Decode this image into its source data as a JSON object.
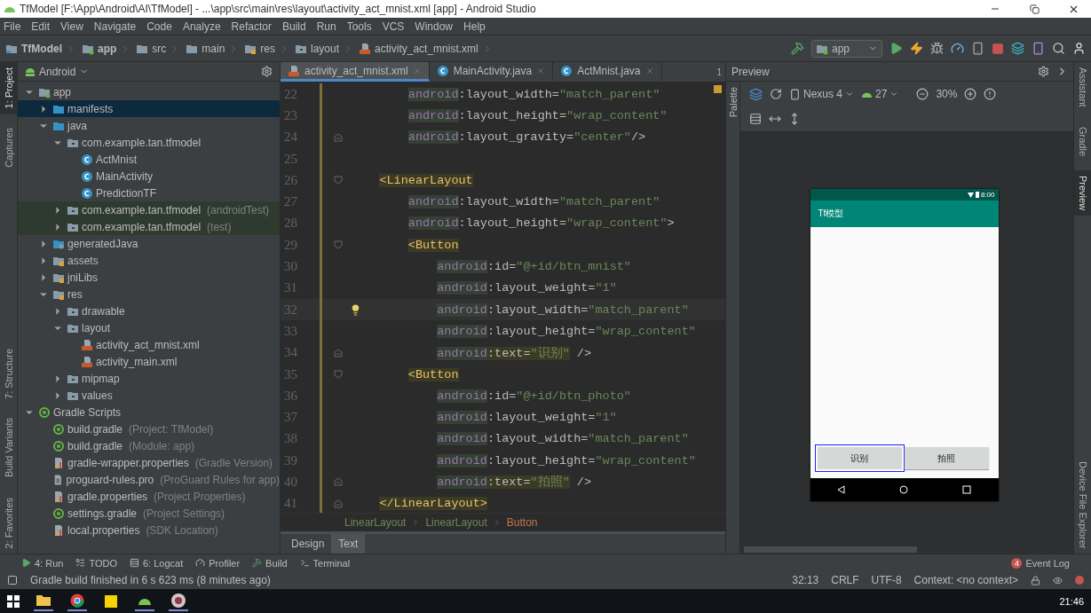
{
  "window": {
    "title": "TfModel [F:\\App\\Android\\AI\\TfModel] - ...\\app\\src\\main\\res\\layout\\activity_act_mnist.xml [app] - Android Studio"
  },
  "menu": [
    "File",
    "Edit",
    "View",
    "Navigate",
    "Code",
    "Analyze",
    "Refactor",
    "Build",
    "Run",
    "Tools",
    "VCS",
    "Window",
    "Help"
  ],
  "navigation": [
    {
      "label": "TfModel",
      "kind": "project"
    },
    {
      "label": "app",
      "kind": "module"
    },
    {
      "label": "src",
      "kind": "folder"
    },
    {
      "label": "main",
      "kind": "folder"
    },
    {
      "label": "res",
      "kind": "res"
    },
    {
      "label": "layout",
      "kind": "package"
    },
    {
      "label": "activity_act_mnist.xml",
      "kind": "layout-file"
    }
  ],
  "toolbar": {
    "run_config": "app"
  },
  "left_stripe": {
    "top": [
      {
        "label": "1: Project",
        "selected": true
      },
      {
        "label": "Captures",
        "selected": false
      }
    ],
    "bottom": [
      {
        "label": "7: Structure",
        "selected": false
      },
      {
        "label": "Build Variants",
        "selected": false
      },
      {
        "label": "2: Favorites",
        "selected": false
      }
    ]
  },
  "project_panel": {
    "view": "Android",
    "tree": [
      {
        "label": "app",
        "kind": "module",
        "selected": false,
        "expanded": true,
        "children": [
          {
            "label": "manifests",
            "kind": "blue-folder",
            "selected": true,
            "expanded": false
          },
          {
            "label": "java",
            "kind": "blue-folder",
            "selected": false,
            "expanded": true,
            "children": [
              {
                "label": "com.example.tan.tfmodel",
                "kind": "package",
                "selected": false,
                "expanded": true,
                "children": [
                  {
                    "label": "ActMnist",
                    "kind": "class",
                    "selected": false
                  },
                  {
                    "label": "MainActivity",
                    "kind": "class",
                    "selected": false
                  },
                  {
                    "label": "PredictionTF",
                    "kind": "class",
                    "selected": false
                  }
                ]
              },
              {
                "label": "com.example.tan.tfmodel",
                "note": "(androidTest)",
                "kind": "package",
                "selected": false,
                "expanded": false,
                "tinted": true
              },
              {
                "label": "com.example.tan.tfmodel",
                "note": "(test)",
                "kind": "package",
                "selected": false,
                "expanded": false,
                "tinted": true
              }
            ]
          },
          {
            "label": "generatedJava",
            "kind": "generated",
            "selected": false,
            "expanded": false
          },
          {
            "label": "assets",
            "kind": "res",
            "selected": false,
            "expanded": false
          },
          {
            "label": "jniLibs",
            "kind": "res",
            "selected": false,
            "expanded": false
          },
          {
            "label": "res",
            "kind": "res",
            "selected": false,
            "expanded": true,
            "children": [
              {
                "label": "drawable",
                "kind": "package",
                "selected": false,
                "expanded": false
              },
              {
                "label": "layout",
                "kind": "package",
                "selected": false,
                "expanded": true,
                "children": [
                  {
                    "label": "activity_act_mnist.xml",
                    "kind": "layout-file",
                    "selected": false
                  },
                  {
                    "label": "activity_main.xml",
                    "kind": "layout-file",
                    "selected": false
                  }
                ]
              },
              {
                "label": "mipmap",
                "kind": "package",
                "selected": false,
                "expanded": false
              },
              {
                "label": "values",
                "kind": "package",
                "selected": false,
                "expanded": false
              }
            ]
          }
        ]
      },
      {
        "label": "Gradle Scripts",
        "kind": "gradle",
        "selected": false,
        "expanded": true,
        "children": [
          {
            "label": "build.gradle",
            "note": "(Project: TfModel)",
            "kind": "gradle",
            "selected": false
          },
          {
            "label": "build.gradle",
            "note": "(Module: app)",
            "kind": "gradle",
            "selected": false
          },
          {
            "label": "gradle-wrapper.properties",
            "note": "(Gradle Version)",
            "kind": "properties",
            "selected": false
          },
          {
            "label": "proguard-rules.pro",
            "note": "(ProGuard Rules for app)",
            "kind": "text-file",
            "selected": false
          },
          {
            "label": "gradle.properties",
            "note": "(Project Properties)",
            "kind": "properties",
            "selected": false
          },
          {
            "label": "settings.gradle",
            "note": "(Project Settings)",
            "kind": "gradle",
            "selected": false
          },
          {
            "label": "local.properties",
            "note": "(SDK Location)",
            "kind": "properties",
            "selected": false
          }
        ]
      }
    ]
  },
  "editor": {
    "tabs": [
      {
        "label": "activity_act_mnist.xml",
        "kind": "layout-file",
        "selected": true
      },
      {
        "label": "MainActivity.java",
        "kind": "class",
        "selected": false
      },
      {
        "label": "ActMnist.java",
        "kind": "class",
        "selected": false
      }
    ],
    "tab_overflow": "1",
    "lines": [
      {
        "number": "22",
        "tokens": [
          {
            "kind": "ns",
            "text": "        android"
          },
          {
            "kind": "attr",
            "text": ":layout_width="
          },
          {
            "kind": "value",
            "text": "\"match_parent\""
          }
        ]
      },
      {
        "number": "23",
        "tokens": [
          {
            "kind": "ns",
            "text": "        android"
          },
          {
            "kind": "attr",
            "text": ":layout_height="
          },
          {
            "kind": "value",
            "text": "\"wrap_content\""
          }
        ]
      },
      {
        "number": "24",
        "fold_end": true,
        "tokens": [
          {
            "kind": "ns",
            "text": "        android"
          },
          {
            "kind": "attr",
            "text": ":layout_gravity="
          },
          {
            "kind": "value",
            "text": "\"center\""
          },
          {
            "kind": "punct",
            "text": "/>"
          }
        ]
      },
      {
        "number": "25"
      },
      {
        "number": "26",
        "fold_start": true,
        "tokens": [
          {
            "kind": "tag",
            "text": "    <LinearLayout"
          }
        ]
      },
      {
        "number": "27",
        "tokens": [
          {
            "kind": "ns",
            "text": "        android"
          },
          {
            "kind": "attr",
            "text": ":layout_width="
          },
          {
            "kind": "value",
            "text": "\"match_parent\""
          }
        ]
      },
      {
        "number": "28",
        "tokens": [
          {
            "kind": "ns",
            "text": "        android"
          },
          {
            "kind": "attr",
            "text": ":layout_height="
          },
          {
            "kind": "value",
            "text": "\"wrap_content\""
          },
          {
            "kind": "punct",
            "text": ">"
          }
        ]
      },
      {
        "number": "29",
        "fold_start": true,
        "tokens": [
          {
            "kind": "tag",
            "text": "        <Button"
          }
        ]
      },
      {
        "number": "30",
        "tokens": [
          {
            "kind": "ns",
            "text": "            android"
          },
          {
            "kind": "attr",
            "text": ":id="
          },
          {
            "kind": "value",
            "text": "\"@+id/btn_mnist\""
          }
        ]
      },
      {
        "number": "31",
        "tokens": [
          {
            "kind": "ns",
            "text": "            android"
          },
          {
            "kind": "attr",
            "text": ":layout_weight="
          },
          {
            "kind": "value",
            "text": "\"1\""
          }
        ]
      },
      {
        "number": "32",
        "current": true,
        "bulb": true,
        "tokens": [
          {
            "kind": "ns",
            "text": "            android"
          },
          {
            "kind": "attr",
            "text": ":layout_width="
          },
          {
            "kind": "value",
            "text": "\"match_parent\""
          }
        ]
      },
      {
        "number": "33",
        "tokens": [
          {
            "kind": "ns",
            "text": "            android"
          },
          {
            "kind": "attr",
            "text": ":layout_height="
          },
          {
            "kind": "value",
            "text": "\"wrap_content\""
          }
        ]
      },
      {
        "number": "34",
        "fold_end": true,
        "tokens": [
          {
            "kind": "ns",
            "text": "            android"
          },
          {
            "kind": "attr-hl",
            "text": ":text="
          },
          {
            "kind": "value-hl",
            "text": "\"识别\""
          },
          {
            "kind": "punct",
            "text": " />"
          }
        ]
      },
      {
        "number": "35",
        "fold_start": true,
        "tokens": [
          {
            "kind": "tag",
            "text": "        <Button"
          }
        ]
      },
      {
        "number": "36",
        "tokens": [
          {
            "kind": "ns",
            "text": "            android"
          },
          {
            "kind": "attr",
            "text": ":id="
          },
          {
            "kind": "value",
            "text": "\"@+id/btn_photo\""
          }
        ]
      },
      {
        "number": "37",
        "tokens": [
          {
            "kind": "ns",
            "text": "            android"
          },
          {
            "kind": "attr",
            "text": ":layout_weight="
          },
          {
            "kind": "value",
            "text": "\"1\""
          }
        ]
      },
      {
        "number": "38",
        "tokens": [
          {
            "kind": "ns",
            "text": "            android"
          },
          {
            "kind": "attr",
            "text": ":layout_width="
          },
          {
            "kind": "value",
            "text": "\"match_parent\""
          }
        ]
      },
      {
        "number": "39",
        "tokens": [
          {
            "kind": "ns",
            "text": "            android"
          },
          {
            "kind": "attr",
            "text": ":layout_height="
          },
          {
            "kind": "value",
            "text": "\"wrap_content\""
          }
        ]
      },
      {
        "number": "40",
        "fold_end": true,
        "tokens": [
          {
            "kind": "ns",
            "text": "            android"
          },
          {
            "kind": "attr-hl",
            "text": ":text="
          },
          {
            "kind": "value-hl",
            "text": "\"拍照\""
          },
          {
            "kind": "punct",
            "text": " />"
          }
        ]
      },
      {
        "number": "41",
        "fold_end": true,
        "tokens": [
          {
            "kind": "tag",
            "text": "    </LinearLayout>"
          }
        ]
      }
    ],
    "breadcrumb": [
      {
        "label": "LinearLayout",
        "selected": false
      },
      {
        "label": "LinearLayout",
        "selected": false
      },
      {
        "label": "Button",
        "selected": true
      }
    ],
    "mode_tabs": [
      {
        "label": "Design",
        "selected": false
      },
      {
        "label": "Text",
        "selected": true
      }
    ]
  },
  "preview": {
    "title": "Preview",
    "palette": "Palette",
    "device": "Nexus 4",
    "api": "27",
    "zoom": "30%",
    "phone": {
      "time": "8:00",
      "app_title": "Tf模型",
      "buttons": [
        {
          "label": "识别",
          "selected": true
        },
        {
          "label": "拍照",
          "selected": false
        }
      ]
    }
  },
  "right_stripe": {
    "top": [
      {
        "label": "Assistant",
        "selected": false
      },
      {
        "label": "Gradle",
        "selected": false
      },
      {
        "label": "Preview",
        "selected": true
      }
    ],
    "bottom": [
      {
        "label": "Device File Explorer",
        "selected": false
      }
    ]
  },
  "tool_windows": [
    {
      "label": "4: Run",
      "kind": "run"
    },
    {
      "label": "TODO",
      "kind": "todo"
    },
    {
      "label": "6: Logcat",
      "kind": "logcat"
    },
    {
      "label": "Profiler",
      "kind": "profiler"
    },
    {
      "label": "Build",
      "kind": "build"
    },
    {
      "label": "Terminal",
      "kind": "terminal"
    }
  ],
  "event_log": {
    "label": "Event Log",
    "count": "4"
  },
  "status_bar": {
    "message": "Gradle build finished in 6 s 623 ms (8 minutes ago)",
    "position": "32:13",
    "line_separator": "CRLF",
    "encoding": "UTF-8",
    "context": "Context: <no context>"
  },
  "taskbar": {
    "time": "21:46"
  }
}
